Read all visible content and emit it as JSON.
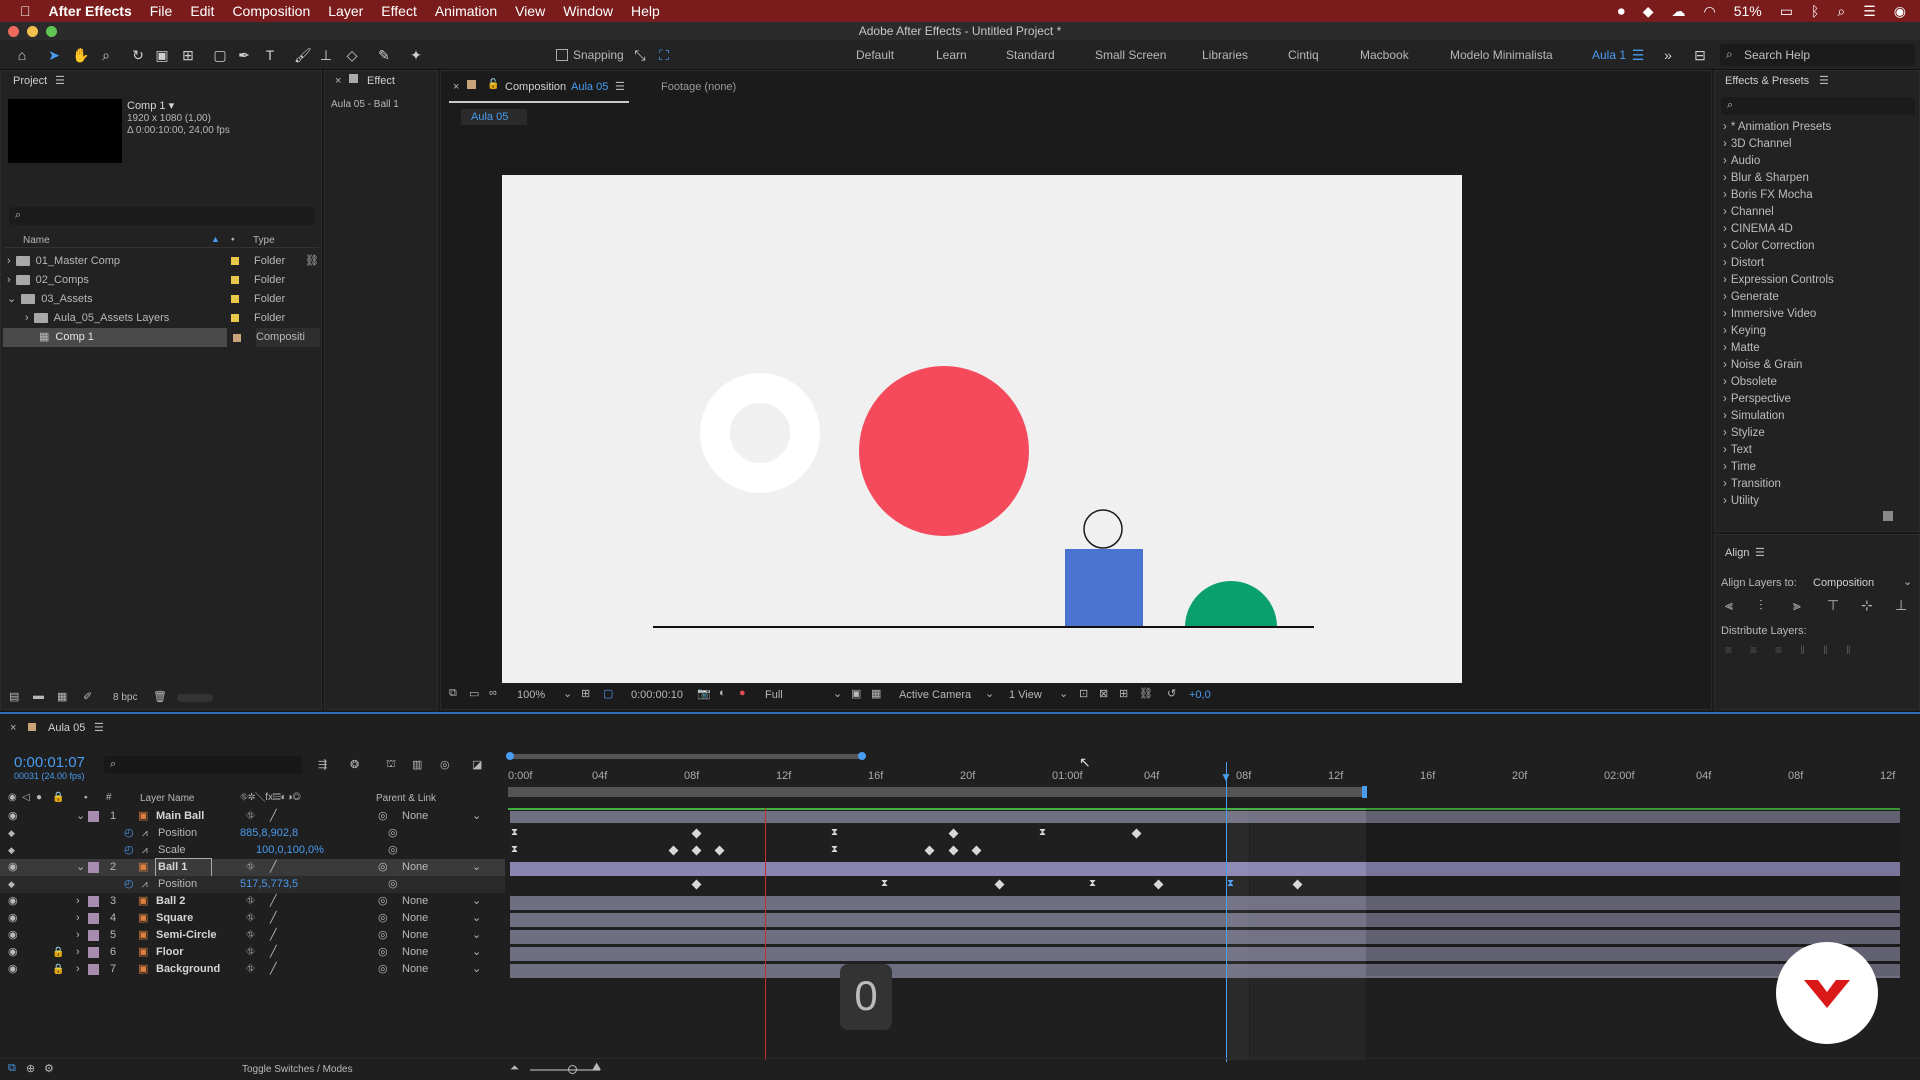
{
  "menubar": {
    "app": "After Effects",
    "items": [
      "File",
      "Edit",
      "Composition",
      "Layer",
      "Effect",
      "Animation",
      "View",
      "Window",
      "Help"
    ],
    "battery": "51%"
  },
  "window_title": "Adobe After Effects - Untitled Project *",
  "toolbar": {
    "snapping": "Snapping",
    "workspaces": [
      "Default",
      "Learn",
      "Standard",
      "Small Screen",
      "Libraries",
      "Cintiq",
      "Macbook",
      "Modelo Minimalista",
      "Aula 1"
    ],
    "active_workspace": "Aula 1",
    "search_help": "Search Help"
  },
  "project": {
    "title": "Project",
    "effect_tab": "Effect",
    "effect_sub": "Aula 05 - Ball 1",
    "comp_name": "Comp 1 ▾",
    "comp_size": "1920 x 1080 (1,00)",
    "comp_dur": "Δ 0:00:10:00, 24,00 fps",
    "col_name": "Name",
    "col_type": "Type",
    "bpc": "8 bpc",
    "items": [
      {
        "name": "01_Master Comp",
        "type": "Folder"
      },
      {
        "name": "02_Comps",
        "type": "Folder"
      },
      {
        "name": "03_Assets",
        "type": "Folder"
      },
      {
        "name": "Aula_05_Assets Layers",
        "type": "Folder"
      },
      {
        "name": "Comp 1",
        "type": "Compositi"
      }
    ]
  },
  "comp": {
    "tab_label": "Composition",
    "tab_name": "Aula 05",
    "footage": "Footage (none)",
    "sub_tab": "Aula 05",
    "zoom": "100%",
    "timecode": "0:00:00:10",
    "resolution": "Full",
    "camera": "Active Camera",
    "views": "1 View",
    "exposure": "+0,0"
  },
  "effects": {
    "title": "Effects & Presets",
    "items": [
      "* Animation Presets",
      "3D Channel",
      "Audio",
      "Blur & Sharpen",
      "Boris FX Mocha",
      "Channel",
      "CINEMA 4D",
      "Color Correction",
      "Distort",
      "Expression Controls",
      "Generate",
      "Immersive Video",
      "Keying",
      "Matte",
      "Noise & Grain",
      "Obsolete",
      "Perspective",
      "Simulation",
      "Stylize",
      "Text",
      "Time",
      "Transition",
      "Utility"
    ]
  },
  "align": {
    "title": "Align",
    "align_to_label": "Align Layers to:",
    "align_to": "Composition",
    "distribute": "Distribute Layers:"
  },
  "timeline": {
    "tab": "Aula 05",
    "timecode": "0:00:01:07",
    "frames": "00031 (24.00 fps)",
    "col_layer": "Layer Name",
    "col_parent": "Parent & Link",
    "toggle": "Toggle Switches / Modes",
    "overlay_digit": "0",
    "ruler": [
      "0:00f",
      "04f",
      "08f",
      "12f",
      "16f",
      "20f",
      "01:00f",
      "04f",
      "08f",
      "12f",
      "16f",
      "20f",
      "02:00f",
      "04f",
      "08f",
      "12f"
    ],
    "layers": [
      {
        "num": "1",
        "name": "Main Ball",
        "parent": "None"
      },
      {
        "prop": "Position",
        "value": "885,8,902,8"
      },
      {
        "prop": "Scale",
        "value": "100,0,100,0%"
      },
      {
        "num": "2",
        "name": "Ball 1",
        "parent": "None"
      },
      {
        "prop": "Position",
        "value": "517,5,773,5"
      },
      {
        "num": "3",
        "name": "Ball 2",
        "parent": "None"
      },
      {
        "num": "4",
        "name": "Square",
        "parent": "None"
      },
      {
        "num": "5",
        "name": "Semi-Circle",
        "parent": "None"
      },
      {
        "num": "6",
        "name": "Floor",
        "parent": "None"
      },
      {
        "num": "7",
        "name": "Background",
        "parent": "None"
      }
    ]
  },
  "colors": {
    "accent": "#2d8ceb",
    "menubar": "#7a1c1c",
    "red_ball": "#f5495c",
    "square": "#4a74d0",
    "semicircle": "#0aa06e",
    "canvas": "#f0f0f0",
    "logo": "#d91818"
  }
}
